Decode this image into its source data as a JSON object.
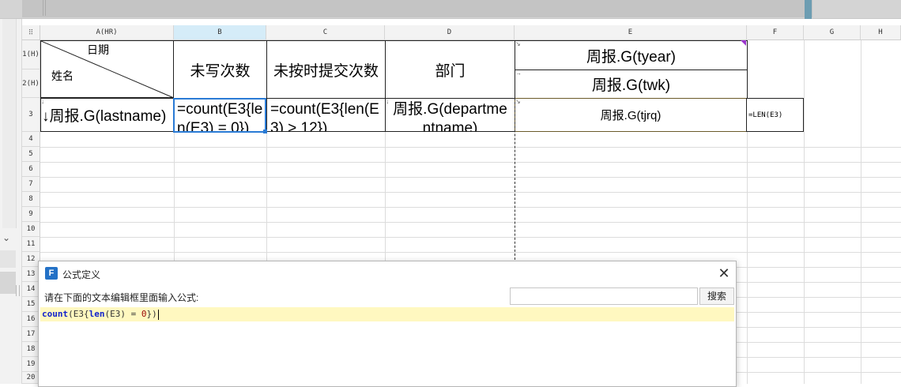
{
  "columns": [
    {
      "label": "A(HR)"
    },
    {
      "label": "B"
    },
    {
      "label": "C"
    },
    {
      "label": "D"
    },
    {
      "label": "E"
    },
    {
      "label": "F"
    },
    {
      "label": "G"
    },
    {
      "label": "H"
    }
  ],
  "rows": [
    "1(H)",
    "2(H)",
    "3",
    "4",
    "5",
    "6",
    "7",
    "8",
    "9",
    "10",
    "11",
    "12",
    "13",
    "14",
    "15",
    "16",
    "17",
    "18",
    "19",
    "20"
  ],
  "header_cells": {
    "diag_top": "日期",
    "diag_bottom": "姓名",
    "b": "未写次数",
    "c": "未按时提交次数",
    "d": "部门",
    "e1": "周报.G(tyear)",
    "e2": "周报.G(twk)"
  },
  "data_cells": {
    "a3": "↓周报.G(lastname)",
    "b3": "=count(E3{len(E3) = 0})",
    "c3": "=count(E3{len(E3) > 12})",
    "d3": "周报.G(departmentname)",
    "e3": "周报.G(tjrq)",
    "f3": "=LEN(E3)"
  },
  "dialog": {
    "title": "公式定义",
    "close_label": "✕",
    "instruction": "请在下面的文本编辑框里面输入公式:",
    "search_placeholder": "",
    "search_value": "",
    "search_button": "搜索",
    "formula": {
      "fn1": "count",
      "p1": "(E3{",
      "fn2": "len",
      "p2": "(E3) = ",
      "num": "0",
      "p3": "})"
    }
  },
  "colors": {
    "selection": "#2a7bd5",
    "header_selected": "#d5ecf8",
    "editor_highlight": "#fff8c0",
    "keyword": "#1122cc"
  }
}
